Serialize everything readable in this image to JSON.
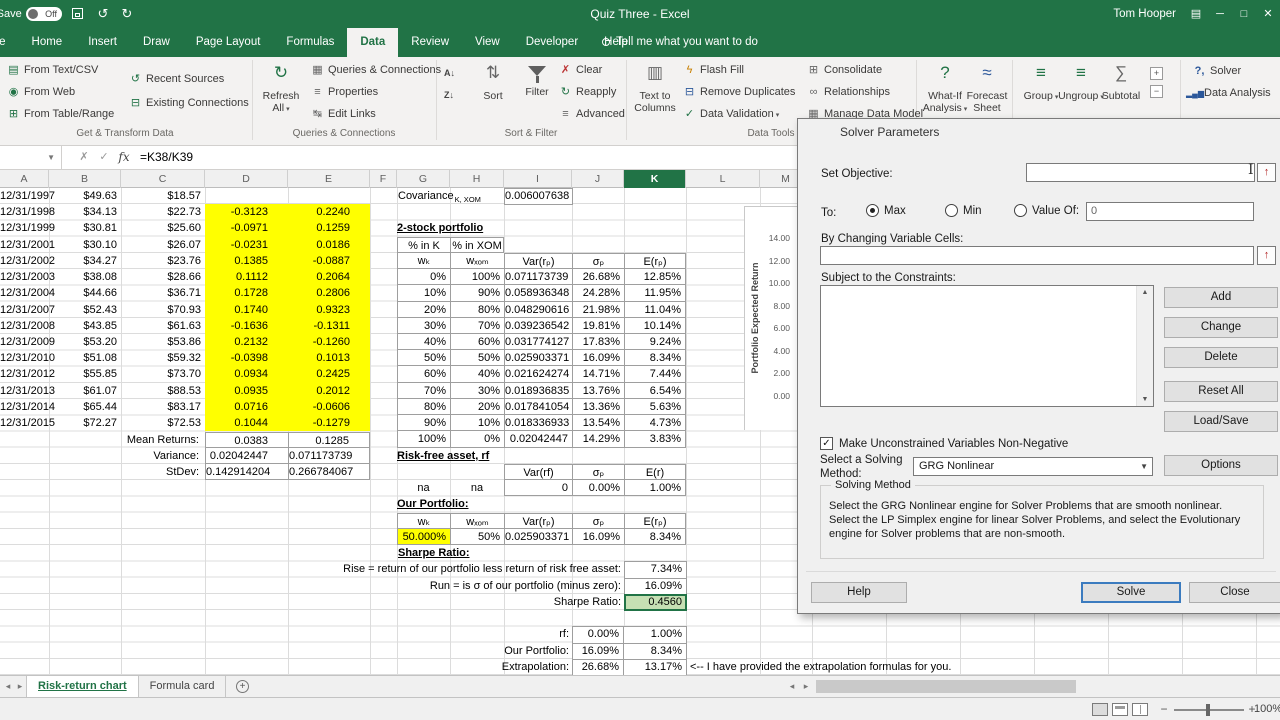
{
  "titlebar": {
    "autosave_label": "AutoSave",
    "autosave_state": "Off",
    "title": "Quiz Three  -  Excel",
    "user": "Tom Hooper"
  },
  "ribbon": {
    "tabs": [
      {
        "label": "File",
        "cls": "file"
      },
      {
        "label": "Home"
      },
      {
        "label": "Insert"
      },
      {
        "label": "Draw"
      },
      {
        "label": "Page Layout"
      },
      {
        "label": "Formulas"
      },
      {
        "label": "Data",
        "cls": "active"
      },
      {
        "label": "Review"
      },
      {
        "label": "View"
      },
      {
        "label": "Developer"
      },
      {
        "label": "Help"
      }
    ],
    "tell_me": "Tell me what you want to do",
    "get_transform": {
      "label": "Get & Transform Data",
      "from_text": "From Text/CSV",
      "from_web": "From Web",
      "from_table": "From Table/Range",
      "recent": "Recent Sources",
      "existing": "Existing Connections"
    },
    "queries": {
      "label": "Queries & Connections",
      "refresh1": "Refresh",
      "refresh2": "All",
      "queries": "Queries & Connections",
      "properties": "Properties",
      "edit_links": "Edit Links"
    },
    "sort_filter": {
      "label": "Sort & Filter",
      "sort": "Sort",
      "filter": "Filter",
      "clear": "Clear",
      "reapply": "Reapply",
      "advanced": "Advanced"
    },
    "data_tools": {
      "label": "Data Tools",
      "ttc1": "Text to",
      "ttc2": "Columns",
      "flash": "Flash Fill",
      "remove": "Remove Duplicates",
      "validation": "Data Validation",
      "consolidate": "Consolidate",
      "relationships": "Relationships",
      "manage": "Manage Data Model"
    },
    "forecast": {
      "whatif1": "What-If",
      "whatif2": "Analysis",
      "fs1": "Forecast",
      "fs2": "Sheet"
    },
    "outline": {
      "group": "Group",
      "ungroup": "Ungroup",
      "subtotal": "Subtotal"
    },
    "analyze": {
      "solver": "Solver",
      "data_analysis": "Data Analysis"
    }
  },
  "formula_bar": {
    "fx": "fx",
    "formula": "=K38/K39"
  },
  "columns": [
    {
      "label": "A"
    },
    {
      "label": "B"
    },
    {
      "label": "C"
    },
    {
      "label": "D"
    },
    {
      "label": "E"
    },
    {
      "label": "F"
    },
    {
      "label": "G"
    },
    {
      "label": "H"
    },
    {
      "label": "I"
    },
    {
      "label": "J"
    },
    {
      "label": "K",
      "cls": "sel"
    },
    {
      "label": "L"
    },
    {
      "label": "M"
    }
  ],
  "sheet": {
    "price_rows": [
      {
        "d": "12/31/1997",
        "k": "$49.63",
        "x": "$18.57",
        "kr": "",
        "xr": ""
      },
      {
        "d": "12/31/1998",
        "k": "$34.13",
        "x": "$22.73",
        "kr": "-0.3123",
        "xr": "0.2240"
      },
      {
        "d": "12/31/1999",
        "k": "$30.81",
        "x": "$25.60",
        "kr": "-0.0971",
        "xr": "0.1259"
      },
      {
        "d": "12/31/2001",
        "k": "$30.10",
        "x": "$26.07",
        "kr": "-0.0231",
        "xr": "0.0186"
      },
      {
        "d": "12/31/2002",
        "k": "$34.27",
        "x": "$23.76",
        "kr": "0.1385",
        "xr": "-0.0887"
      },
      {
        "d": "12/31/2003",
        "k": "$38.08",
        "x": "$28.66",
        "kr": "0.1112",
        "xr": "0.2064"
      },
      {
        "d": "12/31/2004",
        "k": "$44.66",
        "x": "$36.71",
        "kr": "0.1728",
        "xr": "0.2806"
      },
      {
        "d": "12/31/2007",
        "k": "$52.43",
        "x": "$70.93",
        "kr": "0.1740",
        "xr": "0.9323"
      },
      {
        "d": "12/31/2008",
        "k": "$43.85",
        "x": "$61.63",
        "kr": "-0.1636",
        "xr": "-0.1311"
      },
      {
        "d": "12/31/2009",
        "k": "$53.20",
        "x": "$53.86",
        "kr": "0.2132",
        "xr": "-0.1260"
      },
      {
        "d": "12/31/2010",
        "k": "$51.08",
        "x": "$59.32",
        "kr": "-0.0398",
        "xr": "0.1013"
      },
      {
        "d": "12/31/2012",
        "k": "$55.85",
        "x": "$73.70",
        "kr": "0.0934",
        "xr": "0.2425"
      },
      {
        "d": "12/31/2013",
        "k": "$61.07",
        "x": "$88.53",
        "kr": "0.0935",
        "xr": "0.2012"
      },
      {
        "d": "12/31/2014",
        "k": "$65.44",
        "x": "$83.17",
        "kr": "0.0716",
        "xr": "-0.0606"
      },
      {
        "d": "12/31/2015",
        "k": "$72.27",
        "x": "$72.53",
        "kr": "0.1044",
        "xr": "-0.1279"
      }
    ],
    "stats": {
      "mean_label": "Mean Returns:",
      "mean_k": "0.0383",
      "mean_xom": "0.1285",
      "var_label": "Variance:",
      "var_k": "0.02042447",
      "var_xom": "0.071173739",
      "sd_label": "StDev:",
      "sd_k": "0.142914204",
      "sd_xom": "0.266784067"
    },
    "covariance": {
      "label": "Covariance",
      "sub": "K, XOM",
      "value": "0.006007638"
    },
    "portfolio": {
      "title": "2-stock portfolio",
      "pct_k": "% in K",
      "pct_xom": "% in XOM",
      "h_wk": "wₖ",
      "h_wx": "wₓₒₘ",
      "h_var": "Var(rₚ)",
      "h_sd": "σₚ",
      "h_er": "E(rₚ)",
      "rows": [
        {
          "wk": "0%",
          "wx": "100%",
          "var": "0.071173739",
          "sd": "26.68%",
          "er": "12.85%"
        },
        {
          "wk": "10%",
          "wx": "90%",
          "var": "0.058936348",
          "sd": "24.28%",
          "er": "11.95%"
        },
        {
          "wk": "20%",
          "wx": "80%",
          "var": "0.048290616",
          "sd": "21.98%",
          "er": "11.04%"
        },
        {
          "wk": "30%",
          "wx": "70%",
          "var": "0.039236542",
          "sd": "19.81%",
          "er": "10.14%"
        },
        {
          "wk": "40%",
          "wx": "60%",
          "var": "0.031774127",
          "sd": "17.83%",
          "er": "9.24%"
        },
        {
          "wk": "50%",
          "wx": "50%",
          "var": "0.025903371",
          "sd": "16.09%",
          "er": "8.34%"
        },
        {
          "wk": "60%",
          "wx": "40%",
          "var": "0.021624274",
          "sd": "14.71%",
          "er": "7.44%"
        },
        {
          "wk": "70%",
          "wx": "30%",
          "var": "0.018936835",
          "sd": "13.76%",
          "er": "6.54%"
        },
        {
          "wk": "80%",
          "wx": "20%",
          "var": "0.017841054",
          "sd": "13.36%",
          "er": "5.63%"
        },
        {
          "wk": "90%",
          "wx": "10%",
          "var": "0.018336933",
          "sd": "13.54%",
          "er": "4.73%"
        },
        {
          "wk": "100%",
          "wx": "0%",
          "var": "0.02042447",
          "sd": "14.29%",
          "er": "3.83%"
        }
      ]
    },
    "risk_free": {
      "title": "Risk-free asset, rf",
      "h_var": "Var(rf)",
      "h_sd": "σₚ",
      "h_er": "E(r)",
      "na1": "na",
      "na2": "na",
      "var": "0",
      "sd": "0.00%",
      "er": "1.00%"
    },
    "our_portfolio": {
      "title": "Our Portfolio:",
      "h_wk": "wₖ",
      "h_wx": "wₓₒₘ",
      "h_var": "Var(rₚ)",
      "h_sd": "σₚ",
      "h_er": "E(rₚ)",
      "wk": "50.000%",
      "wx": "50%",
      "var": "0.025903371",
      "sd": "16.09%",
      "er": "8.34%"
    },
    "sharpe": {
      "title": "Sharpe Ratio:",
      "rise_label": "Rise = return of our portfolio less return of risk free asset:",
      "rise": "7.34%",
      "run_label": "Run = is σ of our portfolio (minus zero):",
      "run": "16.09%",
      "ratio_label": "Sharpe Ratio:",
      "ratio": "0.4560"
    },
    "extrap": {
      "rows": [
        {
          "label": "rf:",
          "j": "0.00%",
          "k": "1.00%"
        },
        {
          "label": "Our Portfolio:",
          "j": "16.09%",
          "k": "8.34%"
        },
        {
          "label": "Extrapolation:",
          "j": "26.68%",
          "k": "13.17%"
        }
      ],
      "note": "<-- I have provided the extrapolation formulas for you."
    },
    "chart": {
      "ylabel": "Portfolio Expected Return",
      "yticks": [
        {
          "label": "14.00"
        },
        {
          "label": "12.00"
        },
        {
          "label": "10.00"
        },
        {
          "label": "8.00"
        },
        {
          "label": "6.00"
        },
        {
          "label": "4.00"
        },
        {
          "label": "2.00"
        },
        {
          "label": "0.00"
        }
      ]
    }
  },
  "sheet_tabs": {
    "tab1": "Risk-return chart",
    "tab2": "Formula card"
  },
  "status": {
    "zoom": "100%"
  },
  "solver": {
    "title": "Solver Parameters",
    "set_objective": "Set Objective:",
    "objective_value": "",
    "to_label": "To:",
    "max": "Max",
    "min": "Min",
    "value_of": "Value Of:",
    "value_of_value": "0",
    "by_changing": "By Changing Variable Cells:",
    "changing_value": "",
    "constraints_label": "Subject to the Constraints:",
    "add": "Add",
    "change": "Change",
    "delete": "Delete",
    "reset_all": "Reset All",
    "load_save": "Load/Save",
    "non_negative": "Make Unconstrained Variables Non-Negative",
    "select_method": "Select a Solving Method:",
    "method": "GRG Nonlinear",
    "options": "Options",
    "solving_method_title": "Solving Method",
    "solving_method_desc": "Select the GRG Nonlinear engine for Solver Problems that are smooth nonlinear. Select the LP Simplex engine for linear Solver Problems, and select the Evolutionary engine for Solver problems that are non-smooth.",
    "help": "Help",
    "solve": "Solve",
    "close": "Close"
  }
}
